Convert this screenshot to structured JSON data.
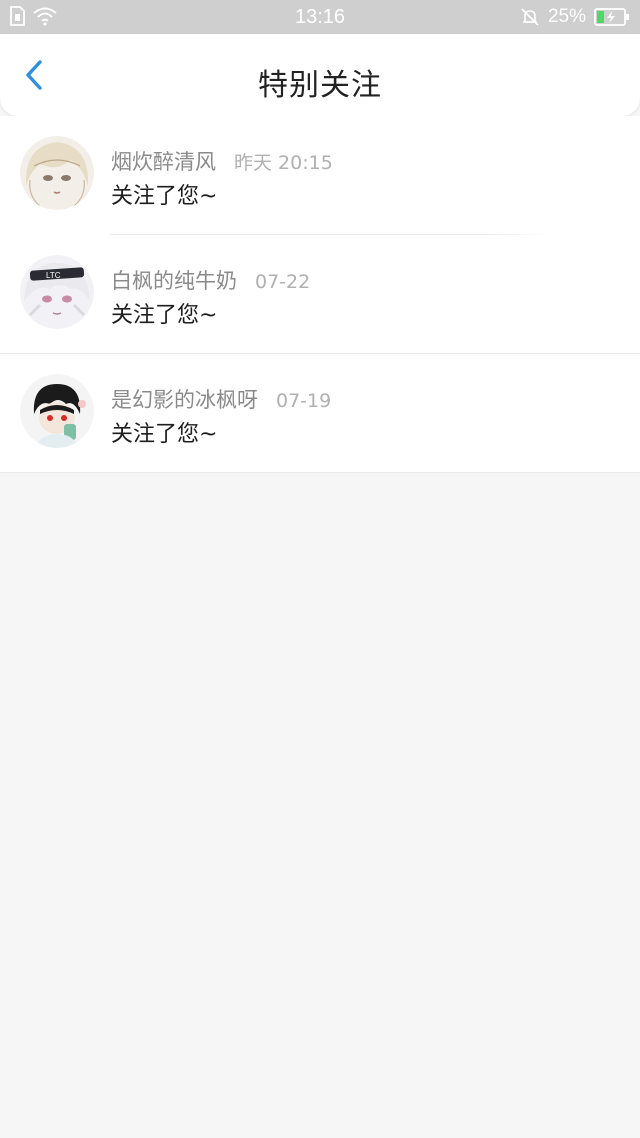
{
  "status_bar": {
    "time": "13:16",
    "battery": "25%",
    "icons": [
      "sim-icon",
      "wifi-icon",
      "bell-muted-icon",
      "battery-charging-icon"
    ]
  },
  "header": {
    "title": "特别关注",
    "back_icon": "chevron-left-icon",
    "accent_color": "#2f8fe0"
  },
  "notifications": [
    {
      "username": "烟炊醉清风",
      "time": "昨天 20:15",
      "message": "关注了您~",
      "avatar": "avatar-light-haired-girl"
    },
    {
      "username": "白枫的纯牛奶",
      "time": "07-22",
      "message": "关注了您~",
      "avatar": "avatar-white-haired-headband"
    },
    {
      "username": "是幻影的冰枫呀",
      "time": "07-19",
      "message": "关注了您~",
      "avatar": "avatar-dark-haired-boy"
    }
  ]
}
